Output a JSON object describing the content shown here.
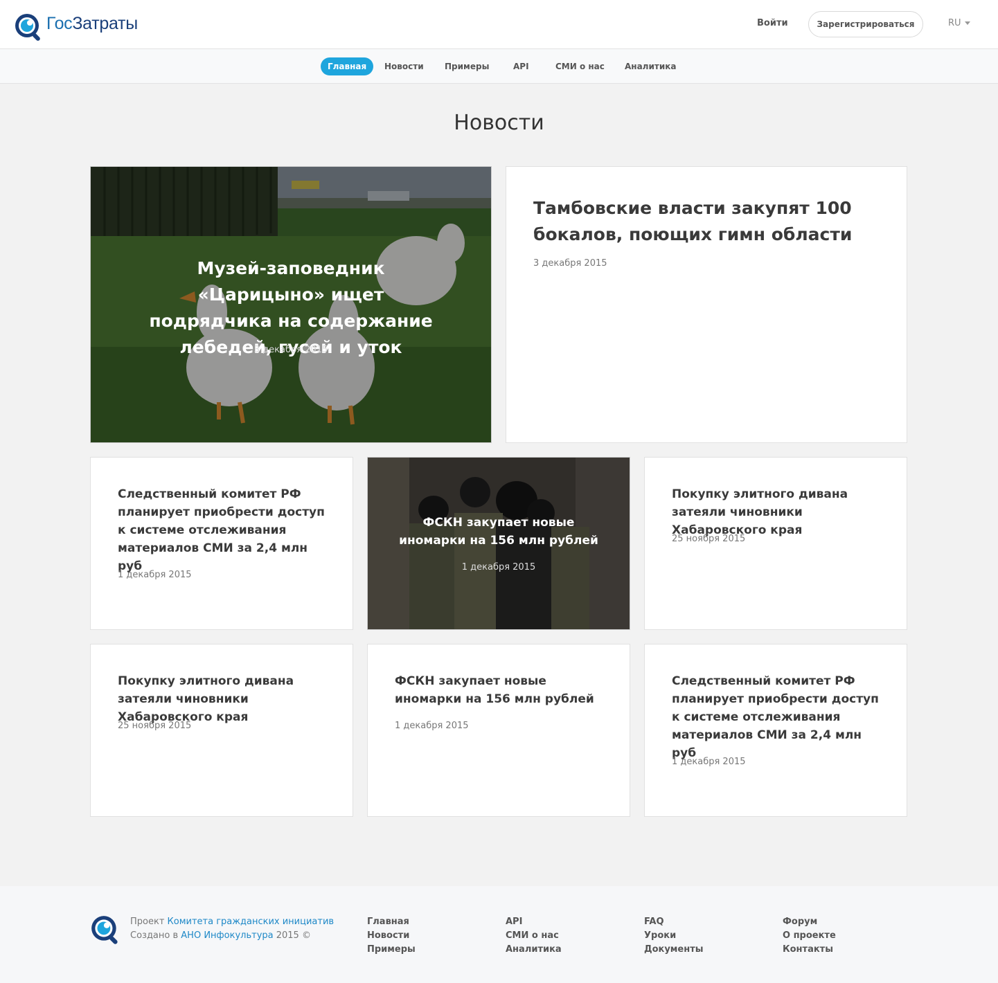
{
  "header": {
    "logo": {
      "part1": "Гос",
      "part2": "Затраты"
    },
    "login": "Войти",
    "register": "Зарегистрироваться",
    "lang": "RU"
  },
  "nav": [
    "Главная",
    "Новости",
    "Примеры",
    "API",
    "СМИ о нас",
    "Аналитика"
  ],
  "page_title": "Новости",
  "cards": [
    {
      "title": "Музей-заповедник «Царицыно» ищет подрядчика на содержание лебедей, гусей и уток",
      "date": "3 декабря 2015",
      "image": "geese-photo"
    },
    {
      "title": "Тамбовские власти закупят 100 бокалов, поющих гимн области",
      "date": "3 декабря 2015"
    },
    {
      "title": "Следственный комитет РФ планирует приобрести доступ к системе отслеживания материалов СМИ за 2,4 млн руб",
      "date": "1 декабря 2015"
    },
    {
      "title": "ФСКН закупает новые иномарки на 156 млн рублей",
      "date": "1 декабря 2015",
      "image": "fskn-officers-photo"
    },
    {
      "title": "Покупку элитного дивана затеяли чиновники Хабаровского края",
      "date": "25 ноября 2015"
    },
    {
      "title": "Покупку элитного дивана затеяли чиновники Хабаровского края",
      "date": "25 ноября 2015"
    },
    {
      "title": "ФСКН закупает новые иномарки на 156 млн рублей",
      "date": "1 декабря 2015"
    },
    {
      "title": "Следственный комитет РФ планирует приобрести доступ к системе отслеживания материалов СМИ за 2,4 млн руб",
      "date": "1 декабря 2015"
    }
  ],
  "footer": {
    "line1_prefix": "Проект ",
    "line1_link": "Комитета гражданских инициатив",
    "line2_prefix": "Создано в ",
    "line2_link": "АНО Инфокультура",
    "line2_suffix": " 2015 ©",
    "cols": [
      [
        "Главная",
        "Новости",
        "Примеры"
      ],
      [
        "API",
        "СМИ о нас",
        "Аналитика"
      ],
      [
        "FAQ",
        "Уроки",
        "Документы"
      ],
      [
        "Форум",
        "О проекте",
        "Контакты"
      ]
    ]
  },
  "colors": {
    "accent": "#1ea5dd",
    "link": "#1e88c7",
    "logo_blue": "#1a6faf",
    "logo_dark": "#1a3f7a"
  }
}
